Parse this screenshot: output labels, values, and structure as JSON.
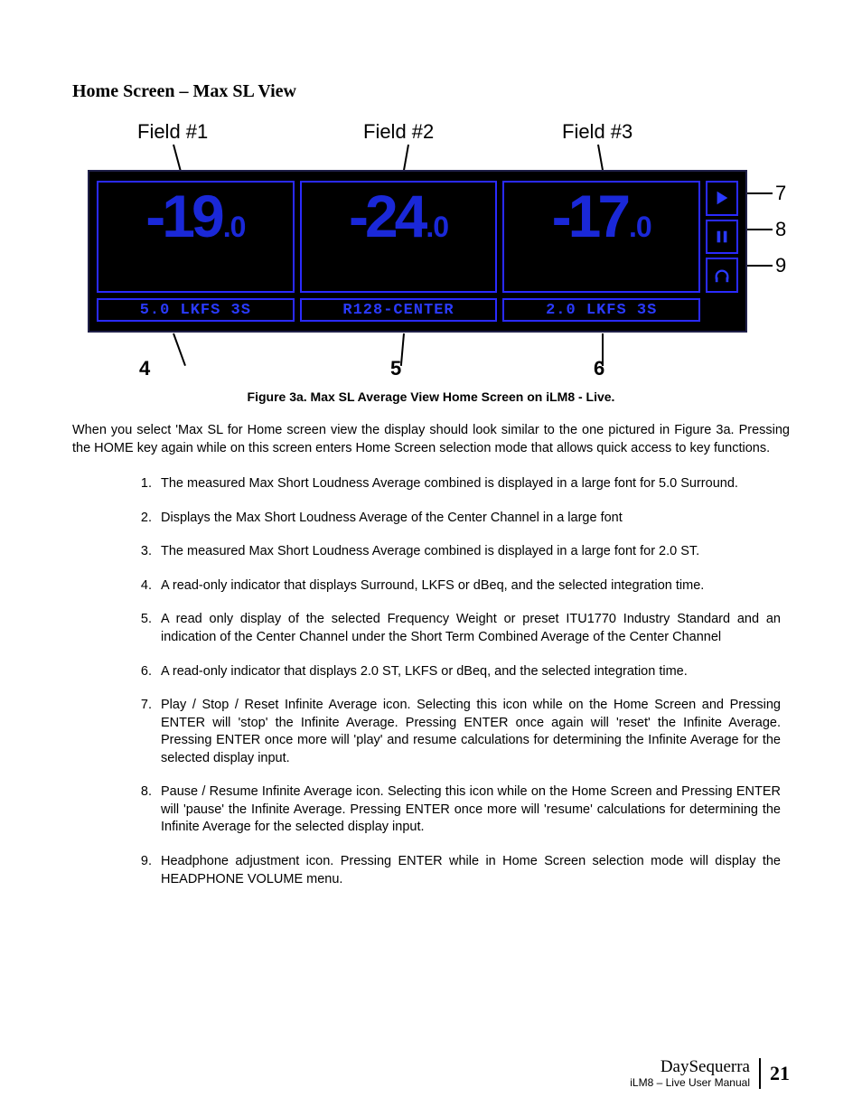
{
  "heading": "Home Screen – Max SL View",
  "topLabels": {
    "f1": "Field #1",
    "f2": "Field #2",
    "f3": "Field #3"
  },
  "fields": {
    "v1_int": "-19",
    "v1_dec": ".0",
    "v2_int": "-24",
    "v2_dec": ".0",
    "v3_int": "-17",
    "v3_dec": ".0"
  },
  "bars": {
    "b4": "5.0 LKFS 3S",
    "b5": "R128-CENTER",
    "b6": "2.0 LKFS 3S"
  },
  "rightNums": {
    "n7": "7",
    "n8": "8",
    "n9": "9"
  },
  "botNums": {
    "n4": "4",
    "n5": "5",
    "n6": "6"
  },
  "caption": "Figure 3a.    Max SL Average View Home Screen on iLM8 - Live.",
  "intro": "When you select 'Max SL for Home screen view the display should look similar to the one pictured in Figure 3a. Pressing the HOME key again while on this screen enters Home Screen selection mode that allows quick access to key functions.",
  "items": [
    "The measured Max Short Loudness Average combined is displayed in a large font for 5.0 Surround.",
    "Displays the Max Short Loudness Average of the Center Channel in a large font",
    "The measured Max Short Loudness Average combined is displayed in a large font for 2.0 ST.",
    "A read-only indicator that displays Surround, LKFS or dBeq, and the selected integration time.",
    "A read only display of the selected Frequency Weight or preset ITU1770 Industry Standard and an indication of the Center Channel under the Short Term Combined Average of the Center Channel",
    "A read-only indicator that displays 2.0 ST, LKFS or dBeq, and the selected integration time.",
    "Play / Stop / Reset Infinite Average icon. Selecting this icon while on the Home Screen and Pressing ENTER will 'stop' the Infinite Average.  Pressing ENTER once again will 'reset' the Infinite Average.  Pressing ENTER once more will 'play' and resume calculations for determining the Infinite Average for the selected display input.",
    "Pause / Resume Infinite Average icon.  Selecting this icon while on the Home Screen and Pressing ENTER will 'pause' the Infinite Average.  Pressing ENTER once more will 'resume' calculations for determining the Infinite Average for the selected display input.",
    "Headphone adjustment icon. Pressing ENTER while in Home Screen selection mode will display the HEADPHONE VOLUME menu."
  ],
  "footer": {
    "brand": "DaySequerra",
    "sub": "iLM8 – Live User Manual",
    "page": "21"
  }
}
